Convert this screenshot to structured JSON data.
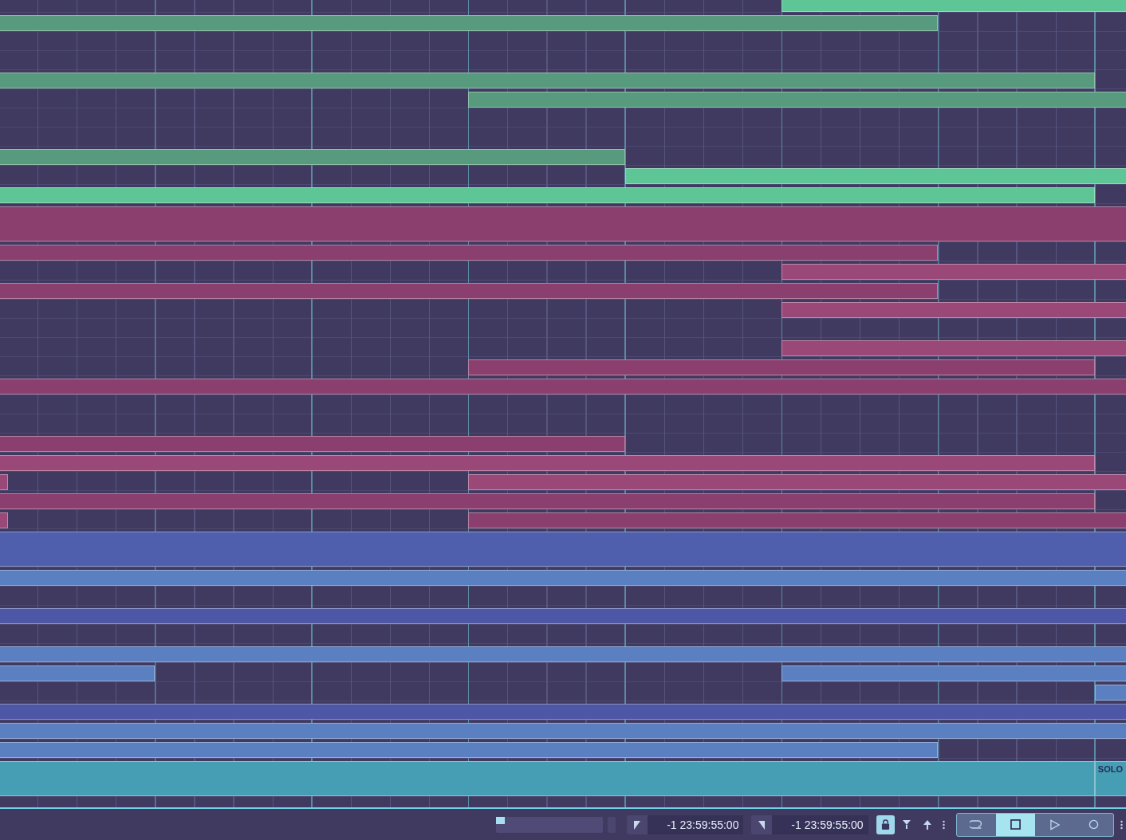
{
  "arrangement": {
    "clips": [
      {
        "color": "#5ec597",
        "kind": "audio"
      },
      {
        "color": "#579a7e",
        "kind": "audio"
      },
      {
        "color": "#579a7e",
        "kind": "midi"
      },
      {
        "color": "#579a7e",
        "kind": "audio"
      },
      {
        "color": "#579a7e",
        "kind": "audio"
      },
      {
        "color": "#5ec597",
        "kind": "audio"
      },
      {
        "color": "#5ec597",
        "kind": "midi"
      },
      {
        "color": "#8a3f6e",
        "kind": "stack"
      },
      {
        "color": "#8a3f6e",
        "kind": "audio"
      },
      {
        "color": "#9a4878",
        "kind": "midi"
      },
      {
        "color": "#8a3f6e",
        "kind": "audio"
      },
      {
        "color": "#9a4878",
        "kind": "midi"
      },
      {
        "color": "#9a4878",
        "kind": "midi"
      },
      {
        "color": "#8a3f6e",
        "kind": "audio"
      },
      {
        "color": "#8a3f6e",
        "kind": "midi"
      },
      {
        "color": "#8a3f6e",
        "kind": "audio"
      },
      {
        "color": "#9a4878",
        "kind": "midi"
      },
      {
        "color": "#9a4878",
        "kind": "audio"
      },
      {
        "color": "#9a4878",
        "kind": "audio"
      },
      {
        "color": "#8a3f6e",
        "kind": "midi"
      },
      {
        "color": "#9a4878",
        "kind": "audio"
      },
      {
        "color": "#8a3f6e",
        "kind": "audio"
      },
      {
        "color": "#4f5fae",
        "kind": "stack"
      },
      {
        "color": "#5b80c2",
        "kind": "audio"
      },
      {
        "color": "#4e56a6",
        "kind": "audio"
      },
      {
        "color": "#5b80c2",
        "kind": "audio"
      },
      {
        "color": "#5b80c2",
        "kind": "audio"
      },
      {
        "color": "#5b80c2",
        "kind": "midi"
      },
      {
        "color": "#5b80c2",
        "kind": "audio"
      },
      {
        "color": "#4e56a6",
        "kind": "midi"
      },
      {
        "color": "#5b80c2",
        "kind": "audio"
      },
      {
        "color": "#5b80c2",
        "kind": "midi"
      },
      {
        "color": "#469eb4",
        "kind": "stack"
      },
      {
        "color": "#469eb4",
        "kind": "stack",
        "label": "SOLO"
      }
    ]
  },
  "transport": {
    "meter": {
      "level": 0.08
    },
    "positions": [
      {
        "text": "-1 23:59:55:00"
      },
      {
        "text": "-1 23:59:55:00"
      }
    ],
    "lock": {
      "on": true
    },
    "buttons": [
      {
        "kind": "loop",
        "selected": false
      },
      {
        "kind": "stop",
        "selected": true
      },
      {
        "kind": "play",
        "selected": false
      },
      {
        "kind": "record",
        "selected": false
      }
    ]
  }
}
